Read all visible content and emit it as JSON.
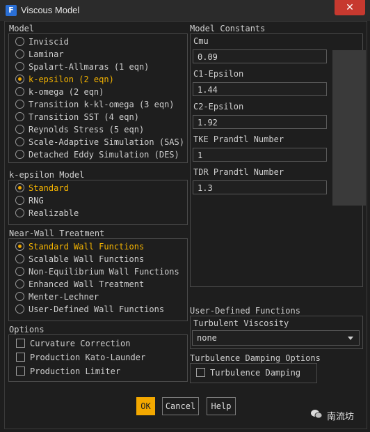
{
  "window": {
    "title": "Viscous Model",
    "icon_letter": "F",
    "close_glyph": "✕"
  },
  "model": {
    "label": "Model",
    "options": [
      {
        "label": "Inviscid",
        "selected": false
      },
      {
        "label": "Laminar",
        "selected": false
      },
      {
        "label": "Spalart-Allmaras (1 eqn)",
        "selected": false
      },
      {
        "label": "k-epsilon (2 eqn)",
        "selected": true
      },
      {
        "label": "k-omega (2 eqn)",
        "selected": false
      },
      {
        "label": "Transition k-kl-omega (3 eqn)",
        "selected": false
      },
      {
        "label": "Transition SST (4 eqn)",
        "selected": false
      },
      {
        "label": "Reynolds Stress (5 eqn)",
        "selected": false
      },
      {
        "label": "Scale-Adaptive Simulation (SAS)",
        "selected": false
      },
      {
        "label": "Detached Eddy Simulation (DES)",
        "selected": false
      }
    ]
  },
  "kepsilon": {
    "label": "k-epsilon Model",
    "options": [
      {
        "label": "Standard",
        "selected": true
      },
      {
        "label": "RNG",
        "selected": false
      },
      {
        "label": "Realizable",
        "selected": false
      }
    ]
  },
  "nearwall": {
    "label": "Near-Wall Treatment",
    "options": [
      {
        "label": "Standard Wall Functions",
        "selected": true
      },
      {
        "label": "Scalable Wall Functions",
        "selected": false
      },
      {
        "label": "Non-Equilibrium Wall Functions",
        "selected": false
      },
      {
        "label": "Enhanced Wall Treatment",
        "selected": false
      },
      {
        "label": "Menter-Lechner",
        "selected": false
      },
      {
        "label": "User-Defined Wall Functions",
        "selected": false
      }
    ]
  },
  "options_group": {
    "label": "Options",
    "items": [
      {
        "label": "Curvature Correction",
        "checked": false
      },
      {
        "label": "Production Kato-Launder",
        "checked": false
      },
      {
        "label": "Production Limiter",
        "checked": false
      }
    ]
  },
  "constants": {
    "label": "Model Constants",
    "fields": [
      {
        "label": "Cmu",
        "value": "0.09"
      },
      {
        "label": "C1-Epsilon",
        "value": "1.44"
      },
      {
        "label": "C2-Epsilon",
        "value": "1.92"
      },
      {
        "label": "TKE Prandtl Number",
        "value": "1"
      },
      {
        "label": "TDR Prandtl Number",
        "value": "1.3"
      }
    ]
  },
  "udf": {
    "label": "User-Defined Functions",
    "turb_visc_label": "Turbulent Viscosity",
    "turb_visc_value": "none"
  },
  "damping": {
    "label": "Turbulence Damping Options",
    "checkbox_label": "Turbulence Damping",
    "checked": false
  },
  "buttons": {
    "ok": "OK",
    "cancel": "Cancel",
    "help": "Help"
  },
  "watermark": {
    "text": "南流坊"
  },
  "colors": {
    "accent": "#f3a800",
    "background": "#1e1e1e",
    "close": "#c7392f"
  }
}
